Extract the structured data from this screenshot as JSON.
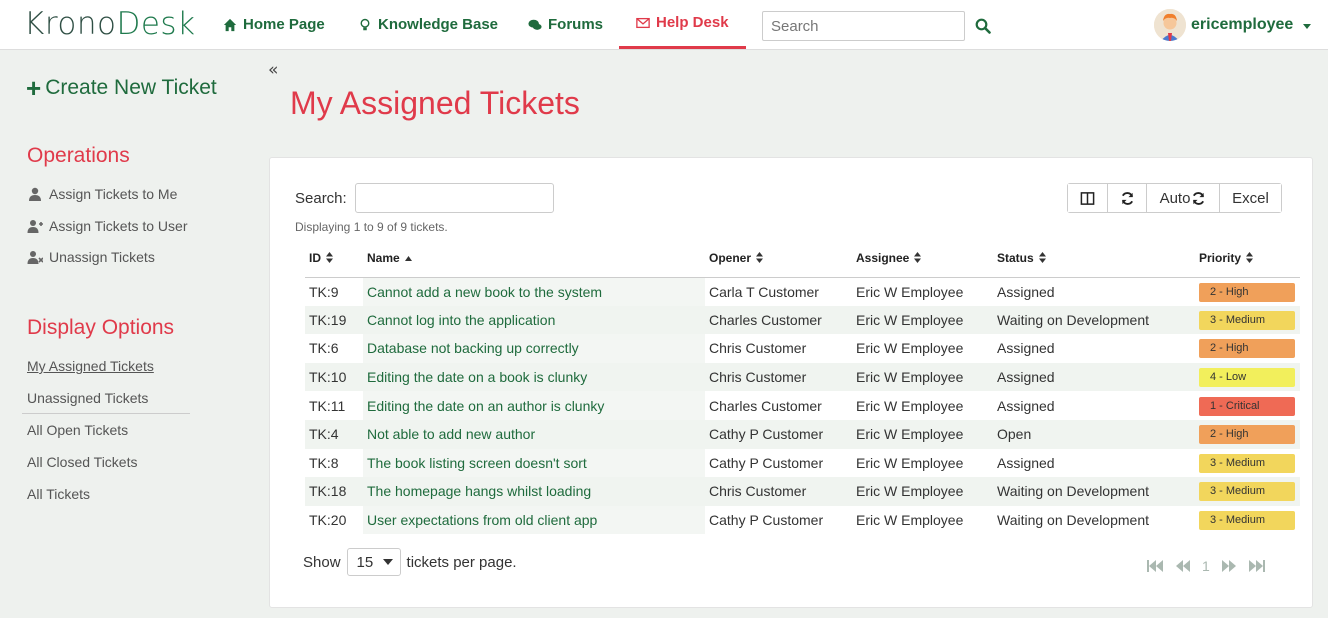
{
  "nav": {
    "logo_a": "Krono",
    "logo_b": "Desk",
    "items": [
      {
        "label": "Home Page",
        "icon": "home-icon"
      },
      {
        "label": "Knowledge Base",
        "icon": "lightbulb-icon"
      },
      {
        "label": "Forums",
        "icon": "comments-icon"
      },
      {
        "label": "Help Desk",
        "icon": "envelope-icon"
      }
    ],
    "search_placeholder": "Search",
    "username": "ericemployee"
  },
  "sidebar": {
    "create_label": "Create New Ticket",
    "operations_title": "Operations",
    "operations": [
      {
        "label": "Assign Tickets to Me",
        "icon": "user-icon"
      },
      {
        "label": "Assign Tickets to User",
        "icon": "user-plus-icon"
      },
      {
        "label": "Unassign Tickets",
        "icon": "user-times-icon"
      }
    ],
    "display_title": "Display Options",
    "display": [
      {
        "label": "My Assigned Tickets"
      },
      {
        "label": "Unassigned Tickets"
      },
      {
        "label": "All Open Tickets"
      },
      {
        "label": "All Closed Tickets"
      },
      {
        "label": "All Tickets"
      }
    ]
  },
  "main": {
    "collapse_glyph": "«",
    "title": "My Assigned Tickets",
    "search_label": "Search:",
    "display_info": "Displaying 1 to 9 of 9 tickets.",
    "toolbar": {
      "auto_label": "Auto",
      "excel_label": "Excel"
    },
    "columns": [
      "ID",
      "Name",
      "Opener",
      "Assignee",
      "Status",
      "Priority"
    ],
    "rows": [
      {
        "id": "TK:9",
        "name": "Cannot add a new book to the system",
        "opener": "Carla T Customer",
        "assignee": "Eric W Employee",
        "status": "Assigned",
        "priority": "2 - High",
        "prio_color": "#f0a05a"
      },
      {
        "id": "TK:19",
        "name": "Cannot log into the application",
        "opener": "Charles Customer",
        "assignee": "Eric W Employee",
        "status": "Waiting on Development",
        "priority": "3 - Medium",
        "prio_color": "#f2d65c"
      },
      {
        "id": "TK:6",
        "name": "Database not backing up correctly",
        "opener": "Chris Customer",
        "assignee": "Eric W Employee",
        "status": "Assigned",
        "priority": "2 - High",
        "prio_color": "#f0a05a"
      },
      {
        "id": "TK:10",
        "name": "Editing the date on a book is clunky",
        "opener": "Chris Customer",
        "assignee": "Eric W Employee",
        "status": "Assigned",
        "priority": "4 - Low",
        "prio_color": "#f2ef5c"
      },
      {
        "id": "TK:11",
        "name": "Editing the date on an author is clunky",
        "opener": "Charles Customer",
        "assignee": "Eric W Employee",
        "status": "Assigned",
        "priority": "1 - Critical",
        "prio_color": "#ef6a55"
      },
      {
        "id": "TK:4",
        "name": "Not able to add new author",
        "opener": "Cathy P Customer",
        "assignee": "Eric W Employee",
        "status": "Open",
        "priority": "2 - High",
        "prio_color": "#f0a05a"
      },
      {
        "id": "TK:8",
        "name": "The book listing screen doesn't sort",
        "opener": "Cathy P Customer",
        "assignee": "Eric W Employee",
        "status": "Assigned",
        "priority": "3 - Medium",
        "prio_color": "#f2d65c"
      },
      {
        "id": "TK:18",
        "name": "The homepage hangs whilst loading",
        "opener": "Chris Customer",
        "assignee": "Eric W Employee",
        "status": "Waiting on Development",
        "priority": "3 - Medium",
        "prio_color": "#f2d65c"
      },
      {
        "id": "TK:20",
        "name": "User expectations from old client app",
        "opener": "Cathy P Customer",
        "assignee": "Eric W Employee",
        "status": "Waiting on Development",
        "priority": "3 - Medium",
        "prio_color": "#f2d65c"
      }
    ],
    "show_label": "Show",
    "per_page": "15",
    "per_page_suffix": "tickets per page.",
    "current_page": "1"
  },
  "colors": {
    "brand_green": "#1f6b3d",
    "accent_red": "#e03a4a"
  }
}
